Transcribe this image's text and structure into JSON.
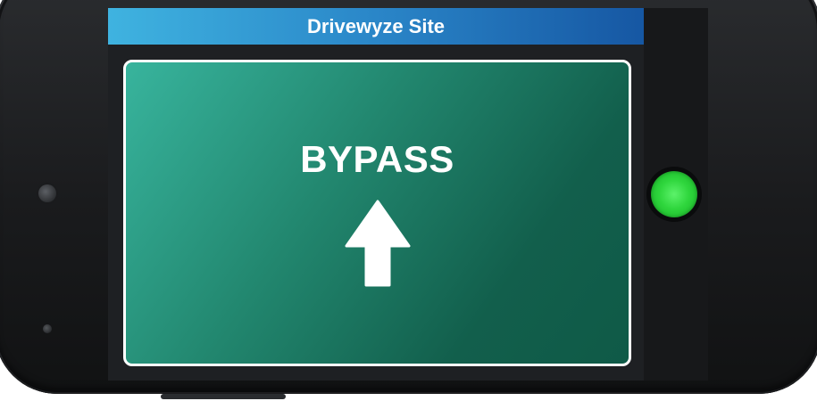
{
  "header": {
    "title": "Drivewyze Site"
  },
  "sign": {
    "status_text": "BYPASS",
    "direction_icon": "arrow-up-icon",
    "bg_color": "#22876f"
  },
  "status_light": {
    "color": "#2fd63d",
    "state": "green"
  },
  "colors": {
    "header_start": "#3fb3e0",
    "header_end": "#1657a3",
    "phone_body": "#1a1b1d"
  }
}
